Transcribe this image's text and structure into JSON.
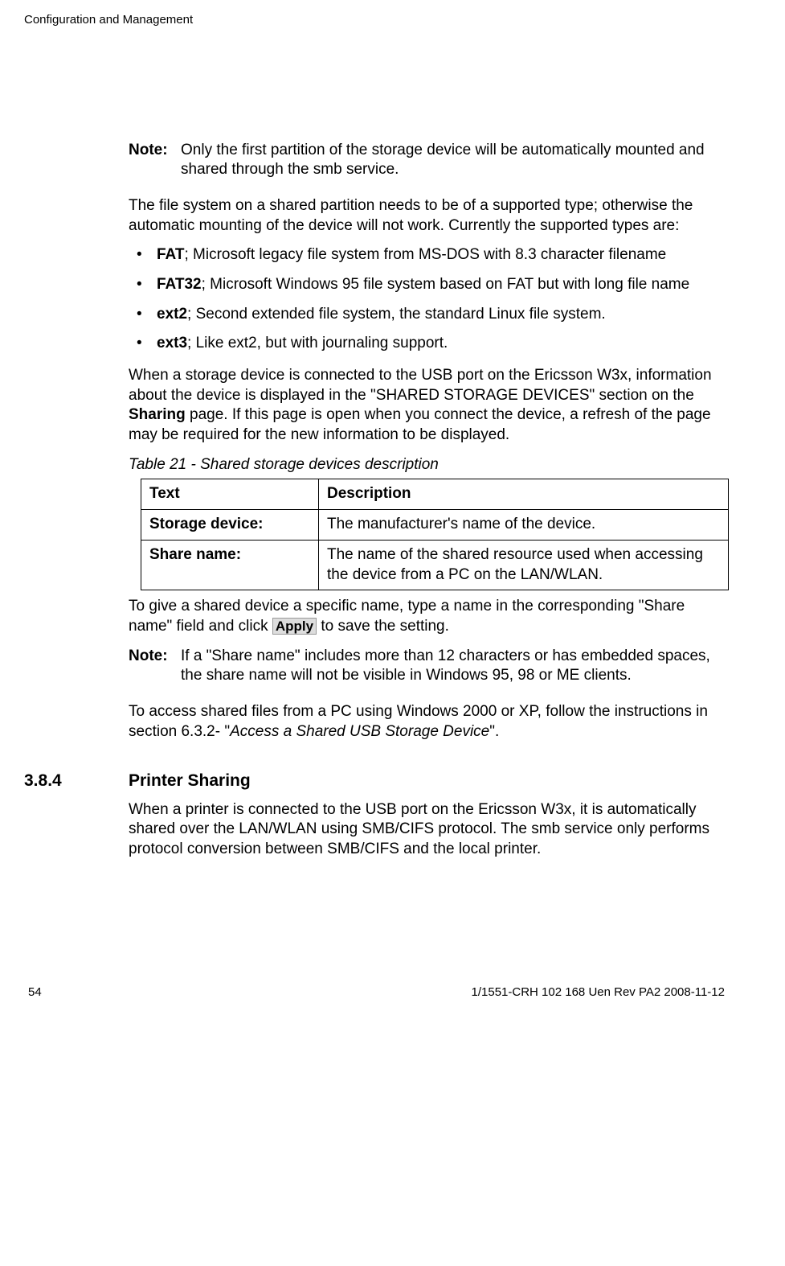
{
  "header": "Configuration and Management",
  "note1": {
    "label": "Note:",
    "text": "Only the first partition of the storage device will be automatically mounted and shared through the smb service."
  },
  "para1": "The file system on a shared partition needs to be of a supported type; otherwise the automatic mounting of the device will not work. Currently the supported types are:",
  "bullets": {
    "b1_bold": "FAT",
    "b1_text": "; Microsoft legacy file system from MS-DOS with 8.3 character filename",
    "b2_bold": "FAT32",
    "b2_text": "; Microsoft Windows 95 file system based on FAT but with long file name",
    "b3_bold": "ext2",
    "b3_text": "; Second extended file system, the standard Linux file system.",
    "b4_bold": "ext3",
    "b4_text": "; Like ext2, but with journaling support."
  },
  "para2_a": "When a storage device is connected to the USB port on the Ericsson W3x, information about the device is displayed in the \"SHARED STORAGE DEVICES\" section on the ",
  "para2_bold": "Sharing",
  "para2_b": " page. If this page is open when you connect the device, a refresh of the page may be required for the new information to be displayed.",
  "table_caption": "Table 21 - Shared storage devices description",
  "table": {
    "h1": "Text",
    "h2": "Description",
    "r1c1": "Storage device:",
    "r1c2": "The manufacturer's name of the device.",
    "r2c1": "Share name:",
    "r2c2": "The name of the shared resource used when accessing the device from a PC on the LAN/WLAN."
  },
  "para3_a": "To give a shared device a specific name, type a name in the corresponding \"Share name\" field and click ",
  "apply_btn": "Apply",
  "para3_b": " to save the setting.",
  "note2": {
    "label": "Note:",
    "text": "If a \"Share name\" includes more than 12 characters or has embedded spaces, the share name will not be visible in Windows 95, 98 or ME clients."
  },
  "para4_a": "To access shared files from a PC using Windows 2000 or XP, follow the instructions in section 6.3.2- \"",
  "para4_italic": "Access a Shared USB Storage Device",
  "para4_b": "\".",
  "section": {
    "num": "3.8.4",
    "title": "Printer Sharing"
  },
  "para5": "When a printer is connected to the USB port on the Ericsson W3x, it is automatically shared over the LAN/WLAN using SMB/CIFS protocol. The smb service only performs protocol conversion between SMB/CIFS and the local printer.",
  "footer": {
    "page": "54",
    "docid": "1/1551-CRH 102 168 Uen Rev PA2  2008-11-12"
  }
}
